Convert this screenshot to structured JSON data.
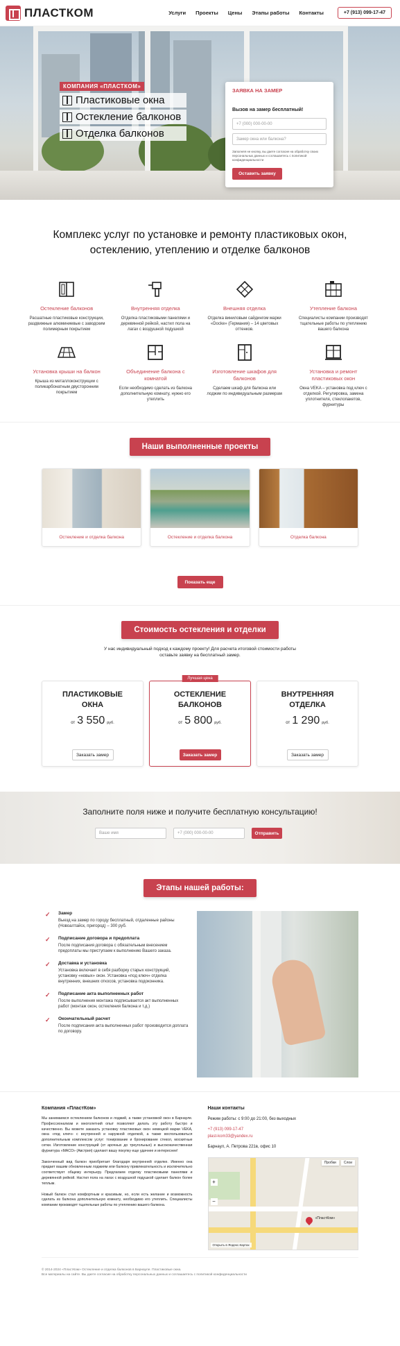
{
  "header": {
    "logo": "ПЛАСТКОМ",
    "nav": [
      "Услуги",
      "Проекты",
      "Цены",
      "Этапы работы",
      "Контакты"
    ],
    "phone": "+7 (913) 099-17-47"
  },
  "hero": {
    "badge": "КОМПАНИЯ «ПЛАСТКОМ»",
    "items": [
      "Пластиковые окна",
      "Остекление балконов",
      "Отделка балконов"
    ],
    "form": {
      "title": "ЗАЯВКА НА ЗАМЕР",
      "subtitle": "Вызов на замер бесплатный!",
      "phone_placeholder": "+7 (000) 000-00-00",
      "question_placeholder": "Замер окна или балкона?",
      "consent": "Заполняя не кнопку, вы даете согласие на обработку своих персональных данных и соглашаетесь с политикой конфиденциальности",
      "button": "Оставить заявку"
    }
  },
  "services": {
    "title_line1": "Комплекс услуг по установке и ремонту пластиковых окон,",
    "title_line2": "остеклению, утеплению и отделке балконов",
    "items": [
      {
        "name": "Остекление балконов",
        "desc": "Расшатные пластиковые конструкции, раздвижные алюминиевые с заводским полимерным покрытием",
        "icon": "window-icon"
      },
      {
        "name": "Внутренняя отделка",
        "desc": "Отделка пластиковыми панелями и деревянной рейкой, настил пола на лагах с воздушной подушкой",
        "icon": "drill-icon"
      },
      {
        "name": "Внешняя отделка",
        "desc": "Отделка виниловым сайдингом марки «Docke» (Германия) – 14 цветовых оттенков.",
        "icon": "tiles-icon"
      },
      {
        "name": "Утепление балкона",
        "desc": "Специалисты компании производят тщательные работы по утеплению вашего балкона",
        "icon": "scaffold-icon"
      },
      {
        "name": "Установка крыши на балкон",
        "desc": "Крыша из металлоконструкции с поликарбонатным двусторонним покрытием",
        "icon": "roof-icon"
      },
      {
        "name": "Объединение балкона с комнатой",
        "desc": "Если необходимо сделать из балкона дополнительную комнату, нужно его утеплить",
        "icon": "floorplan-icon"
      },
      {
        "name": "Изготовление шкафов для балконов",
        "desc": "Сделаем шкаф для балкона или лоджии по индивидуальным размерам",
        "icon": "cabinet-icon"
      },
      {
        "name": "Установка и ремонт пластиковых окон",
        "desc": "Окна VEKA – установка под ключ с отделкой. Регулировка, замена уплотнителя, стеклопакетов, фурнитуры",
        "icon": "window-repair-icon"
      }
    ]
  },
  "projects": {
    "title": "Наши выполненные проекты",
    "items": [
      "Остекление и отделка балкона",
      "Остекление и отделка балкона",
      "Отделка балкона"
    ],
    "more": "Показать еще"
  },
  "prices": {
    "title": "Стоимость остекления и отделки",
    "note": "У нас индивидуальный подход к каждому проекту! Для расчета итоговой стоимости работы оставьте заявку на бесплатный замер.",
    "best_tag": "Лучшая цена",
    "from": "от",
    "currency": "руб.",
    "cards": [
      {
        "name1": "ПЛАСТИКОВЫЕ",
        "name2": "ОКНА",
        "price": "3 550",
        "button": "Заказать замер"
      },
      {
        "name1": "ОСТЕКЛЕНИЕ",
        "name2": "БАЛКОНОВ",
        "price": "5 800",
        "button": "Заказать замер"
      },
      {
        "name1": "ВНУТРЕННЯЯ",
        "name2": "ОТДЕЛКА",
        "price": "1 290",
        "button": "Заказать замер"
      }
    ]
  },
  "consult": {
    "title": "Заполните поля ниже и получите бесплатную консультацию!",
    "name_placeholder": "Ваше имя",
    "phone_placeholder": "+7 (000) 000-00-00",
    "button": "Отправить"
  },
  "steps": {
    "title": "Этапы нашей работы:",
    "items": [
      {
        "name": "Замер",
        "desc": "Выезд на замер по городу бесплатный, отдаленные районы (Новоалтайск, пригород) – 300 руб."
      },
      {
        "name": "Подписание договора и предоплата",
        "desc": "После подписания договора с обязательным внесением предоплаты мы приступаем к выполнению Вашего заказа."
      },
      {
        "name": "Доставка и установка",
        "desc": "Установка включает в себя разборку старых конструкций, установку «новых» окон. Установка «под ключ» отделка внутренних, внешних откосов, установка подоконника."
      },
      {
        "name": "Подписание акта выполненных работ",
        "desc": "После выполнения монтажа подписывается акт выполненных работ (монтаж окон, остекления балкона и т.д.)"
      },
      {
        "name": "Окончательный расчет",
        "desc": "После подписания акта выполненных работ производится доплата по договору."
      }
    ]
  },
  "footer": {
    "about_title": "Компания «ПластКом»",
    "about_p1": "Мы занимаемся остеклением балконов и лоджий, а также установкой окон в Барнауле. Профессионализм и многолетний опыт позволяют делать эту работу быстро и качественно. Вы можете заказать установку пластиковых окон немецкой марки VEKA, окна «под ключ» с внутренней и наружной отделкой, а также воспользоваться дополнительным комплексом услуг: тонирование и бронирование стекол, москитные сетки. Изготовление конструкций (от арочных до треугольных) и высококачественная фурнитура «MACO» (Австрия) сделают вашу покупку еще удачнее и интереснее!",
    "about_p2": "Законченный вид балкон приобретает благодаря внутренней отделке. Именно она придает вашим обновленным лоджиям или балкону привлекательность и исключительно соответствует общему интерьеру. Предлагаем отделку пластиковыми панелями и деревянной рейкой. Настил пола на лагах с воздушной подушкой сделает балкон более теплым.",
    "about_p3": "Новый балкон стал комфортным и красивым, но, если есть желание и возможность сделать из балкона дополнительную комнату, необходимо его утеплить. Специалисты компании производят тщательные работы по утеплению вашего балкона.",
    "contacts_title": "Наши контакты",
    "hours": "Режим работы: с 9:00 до 21:00, без выходных",
    "phone": "+7 (913) 099-17-47",
    "email": "plast-kom33@yandex.ru",
    "address": "Барнаул, А. Петрова 221в, офис 10",
    "map_pin": "«ПластКом»",
    "map_layer": "Слои",
    "map_routes": "Пробки",
    "map_open": "Открыть в Яндекс.Картах"
  },
  "copyright": {
    "line1": "© 2014-2024 «ПластКом» Остекление и отделка балконов в Барнауле. Пластиковые окна.",
    "line2": "Все материалы на сайте. Вы даете согласие на обработку персональных данных и соглашаетесь с политикой конфиденциальности"
  },
  "colors": {
    "accent": "#c8424f"
  }
}
